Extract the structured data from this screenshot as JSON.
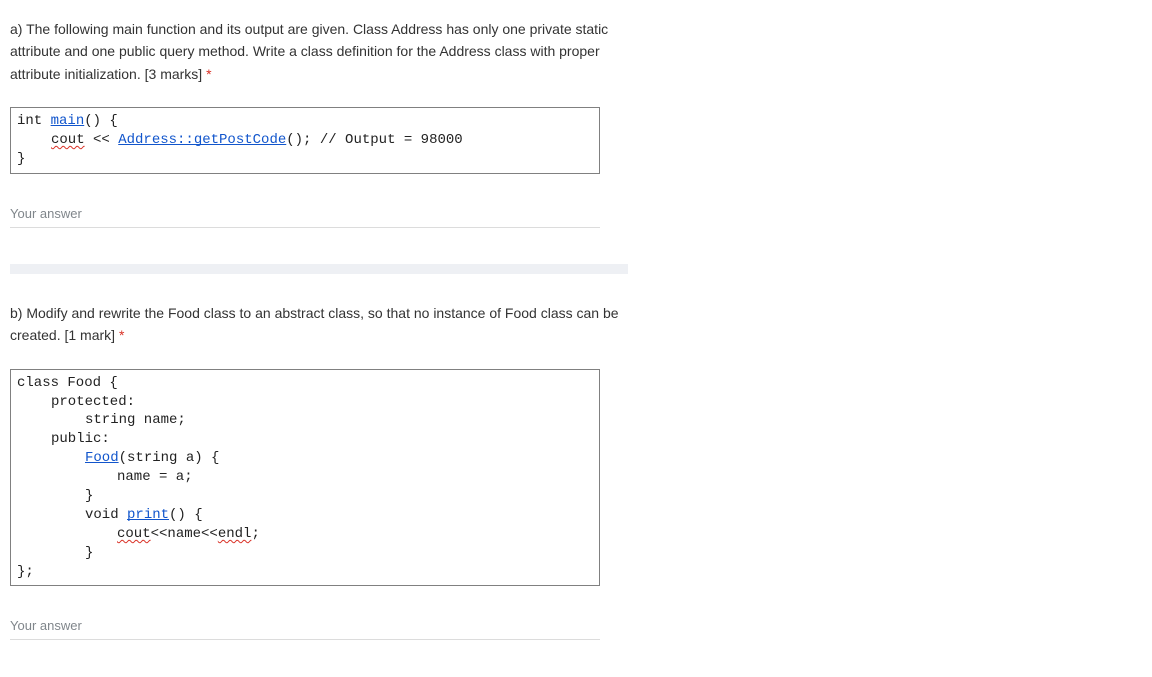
{
  "qa": {
    "text": "a) The following main function and its output are given. Class Address has only one private static attribute and one public query method. Write a class definition for the Address class with proper attribute initialization. [3 marks]",
    "star": "*",
    "code": {
      "l1a": "int ",
      "l1b": "main",
      "l1c": "() {",
      "l2a": "cout",
      "l2b": " << ",
      "l2c": "Address::getPostCode",
      "l2d": "(); // Output = 98000",
      "l3": "}"
    },
    "placeholder": "Your answer"
  },
  "qb": {
    "text": "b) Modify and rewrite the Food class to an abstract class, so that no instance of Food class can be created. [1 mark]",
    "star": "*",
    "code": {
      "l1": "class Food {",
      "l2": "protected:",
      "l3": "string name;",
      "l4": "public:",
      "l5a": "Food",
      "l5b": "(string a) {",
      "l6": "name = a;",
      "l7": "}",
      "l8a": "void ",
      "l8b": "print",
      "l8c": "() {",
      "l9a": "cout",
      "l9b": "<<name<<",
      "l9c": "endl",
      "l9d": ";",
      "l10": "}",
      "l11": "};"
    },
    "placeholder": "Your answer"
  }
}
